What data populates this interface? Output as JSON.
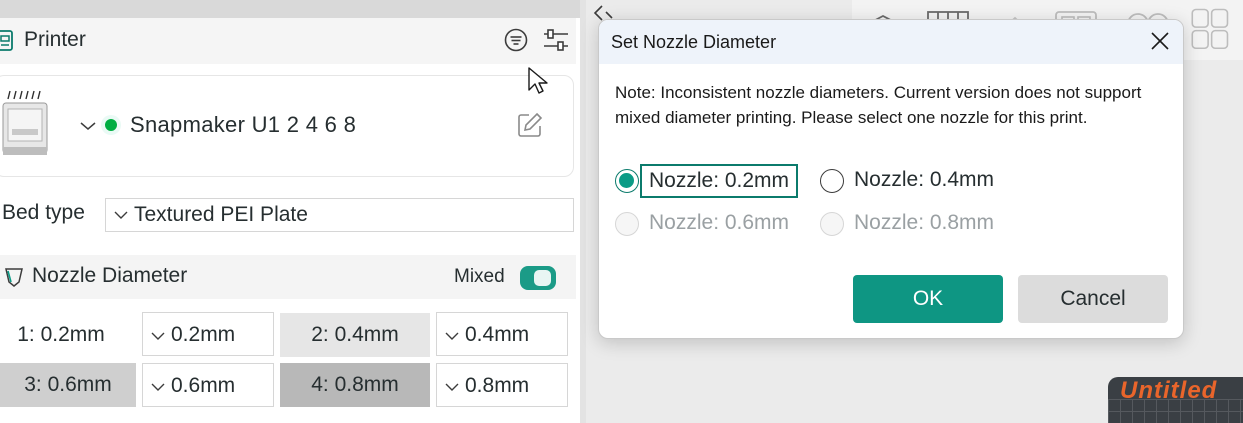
{
  "printer_panel": {
    "title": "Printer",
    "printer_name": "Snapmaker U1 2 4 6 8",
    "status_color": "#00ae42",
    "bed_type_label": "Bed type",
    "bed_type_value": "Textured PEI Plate"
  },
  "nozzle_panel": {
    "title": "Nozzle Diameter",
    "mixed_label": "Mixed",
    "mixed_enabled": true,
    "accent": "#1b9b87",
    "rows": [
      {
        "label": "1: 0.2mm",
        "value": "0.2mm"
      },
      {
        "label": "2: 0.4mm",
        "value": "0.4mm"
      },
      {
        "label": "3: 0.6mm",
        "value": "0.6mm"
      },
      {
        "label": "4: 0.8mm",
        "value": "0.8mm"
      }
    ]
  },
  "dialog": {
    "title": "Set Nozzle Diameter",
    "note": "Note: Inconsistent nozzle diameters. Current version does not support mixed diameter printing. Please select one nozzle for this print.",
    "options": [
      {
        "label": "Nozzle: 0.2mm",
        "selected": true,
        "enabled": true
      },
      {
        "label": "Nozzle: 0.4mm",
        "selected": false,
        "enabled": true
      },
      {
        "label": "Nozzle: 0.6mm",
        "selected": false,
        "enabled": false
      },
      {
        "label": "Nozzle: 0.8mm",
        "selected": false,
        "enabled": false
      }
    ],
    "ok_label": "OK",
    "cancel_label": "Cancel",
    "ok_color": "#0e9683"
  },
  "canvas": {
    "watermark_text": "Untitled"
  }
}
